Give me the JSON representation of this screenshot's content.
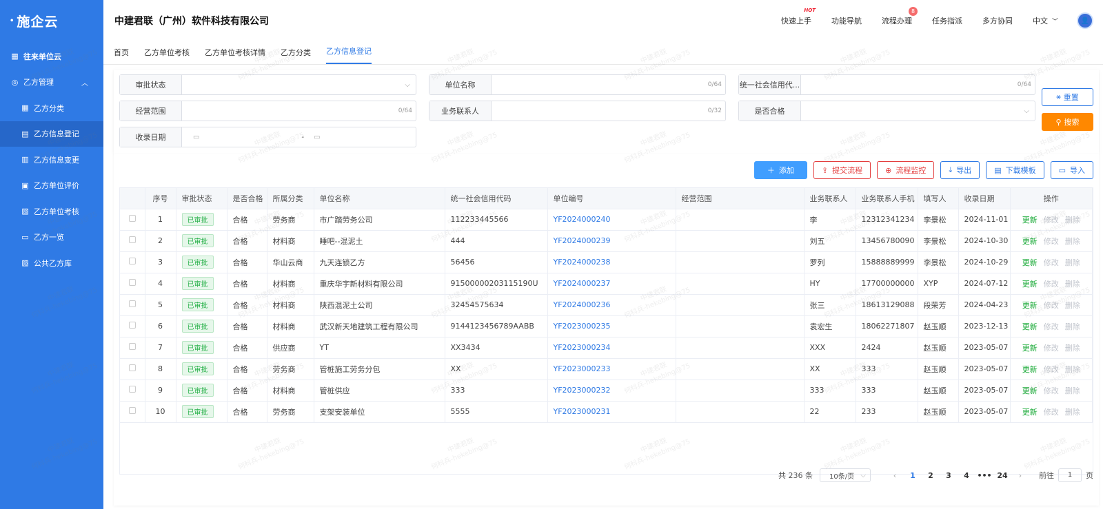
{
  "brand": {
    "logo": "施企云"
  },
  "company": "中建君联（广州）软件科技有限公司",
  "header_menu": {
    "quick_start": "快速上手",
    "hot_badge": "HOT",
    "func_nav": "功能导航",
    "flow": "流程办理",
    "flow_badge": "8",
    "task": "任务指派",
    "collab": "多方协同",
    "lang": "中文"
  },
  "sidebar": {
    "top": "往来单位云",
    "group": "乙方管理",
    "items": [
      {
        "label": "乙方分类",
        "icon": "grid-icon"
      },
      {
        "label": "乙方信息登记",
        "icon": "register-icon"
      },
      {
        "label": "乙方信息变更",
        "icon": "edit-doc-icon"
      },
      {
        "label": "乙方单位评价",
        "icon": "clipboard-icon"
      },
      {
        "label": "乙方单位考核",
        "icon": "assess-icon"
      },
      {
        "label": "乙方一览",
        "icon": "card-icon"
      },
      {
        "label": "公共乙方库",
        "icon": "library-icon"
      }
    ]
  },
  "tabs": [
    "首页",
    "乙方单位考核",
    "乙方单位考核详情",
    "乙方分类",
    "乙方信息登记"
  ],
  "filters": {
    "status": "审批状态",
    "unit_name": "单位名称",
    "unit_name_count": "0/64",
    "credit_code": "统一社会信用代...",
    "credit_code_count": "0/64",
    "scope": "经营范围",
    "scope_count": "0/64",
    "contact": "业务联系人",
    "contact_count": "0/32",
    "qualified": "是否合格",
    "date": "收录日期",
    "date_sep": "-",
    "reset": "重置",
    "search": "搜索"
  },
  "toolbar": {
    "add": "添加",
    "submit": "提交流程",
    "monitor": "流程监控",
    "export": "导出",
    "template": "下载模板",
    "import": "导入"
  },
  "table": {
    "headers": [
      "序号",
      "审批状态",
      "是否合格",
      "所属分类",
      "单位名称",
      "统一社会信用代码",
      "单位编号",
      "经营范围",
      "业务联系人",
      "业务联系人手机",
      "填写人",
      "收录日期",
      "操作"
    ],
    "ops": [
      "更新",
      "修改",
      "删除"
    ],
    "rows": [
      {
        "no": "1",
        "status": "已审批",
        "qual": "合格",
        "cat": "劳务商",
        "name": "市广踏劳务公司",
        "code": "112233445566",
        "sn": "YF2024000240",
        "scope": "",
        "contact": "李",
        "phone": "12312341234",
        "writer": "李景松",
        "date": "2024-11-01"
      },
      {
        "no": "2",
        "status": "已审批",
        "qual": "合格",
        "cat": "材料商",
        "name": "睡吧--混泥土",
        "code": "444",
        "sn": "YF2024000239",
        "scope": "",
        "contact": "刘五",
        "phone": "13456780090",
        "writer": "李景松",
        "date": "2024-10-30"
      },
      {
        "no": "3",
        "status": "已审批",
        "qual": "合格",
        "cat": "华山云商",
        "name": "九天连锁乙方",
        "code": "56456",
        "sn": "YF2024000238",
        "scope": "",
        "contact": "罗列",
        "phone": "15888889999",
        "writer": "李景松",
        "date": "2024-10-29"
      },
      {
        "no": "4",
        "status": "已审批",
        "qual": "合格",
        "cat": "材料商",
        "name": "重庆华宇新材料有限公司",
        "code": "91500000203115190U",
        "sn": "YF2024000237",
        "scope": "",
        "contact": "HY",
        "phone": "17700000000",
        "writer": "XYP",
        "date": "2024-07-12"
      },
      {
        "no": "5",
        "status": "已审批",
        "qual": "合格",
        "cat": "材料商",
        "name": "陕西混泥土公司",
        "code": "32454575634",
        "sn": "YF2024000236",
        "scope": "",
        "contact": "张三",
        "phone": "18613129088",
        "writer": "段荣芳",
        "date": "2024-04-23"
      },
      {
        "no": "6",
        "status": "已审批",
        "qual": "合格",
        "cat": "材料商",
        "name": "武汉新天地建筑工程有限公司",
        "code": "9144123456789AABB",
        "sn": "YF2023000235",
        "scope": "",
        "contact": "袁宏生",
        "phone": "18062271807",
        "writer": "赵玉顺",
        "date": "2023-12-13"
      },
      {
        "no": "7",
        "status": "已审批",
        "qual": "合格",
        "cat": "供应商",
        "name": "YT",
        "code": "XX3434",
        "sn": "YF2023000234",
        "scope": "",
        "contact": "XXX",
        "phone": "2424",
        "writer": "赵玉顺",
        "date": "2023-05-07"
      },
      {
        "no": "8",
        "status": "已审批",
        "qual": "合格",
        "cat": "劳务商",
        "name": "管桩施工劳务分包",
        "code": "XX",
        "sn": "YF2023000233",
        "scope": "",
        "contact": "XX",
        "phone": "333",
        "writer": "赵玉顺",
        "date": "2023-05-07"
      },
      {
        "no": "9",
        "status": "已审批",
        "qual": "合格",
        "cat": "材料商",
        "name": "管桩供应",
        "code": "333",
        "sn": "YF2023000232",
        "scope": "",
        "contact": "333",
        "phone": "333",
        "writer": "赵玉顺",
        "date": "2023-05-07"
      },
      {
        "no": "10",
        "status": "已审批",
        "qual": "合格",
        "cat": "劳务商",
        "name": "支架安装单位",
        "code": "5555",
        "sn": "YF2023000231",
        "scope": "",
        "contact": "22",
        "phone": "233",
        "writer": "赵玉顺",
        "date": "2023-05-07"
      }
    ]
  },
  "pager": {
    "total": "共 236 条",
    "size": "10条/页",
    "pages": [
      "1",
      "2",
      "3",
      "4",
      "•••",
      "24"
    ],
    "goto_label": "前往",
    "goto_value": "1",
    "goto_unit": "页"
  },
  "watermark": {
    "line1": "中建君联",
    "line2": "何科兵-hekebing@75"
  },
  "colors": {
    "primary": "#2f7ae5",
    "search": "#ff8800",
    "success": "#2bb24c",
    "danger": "#e43d3d"
  }
}
